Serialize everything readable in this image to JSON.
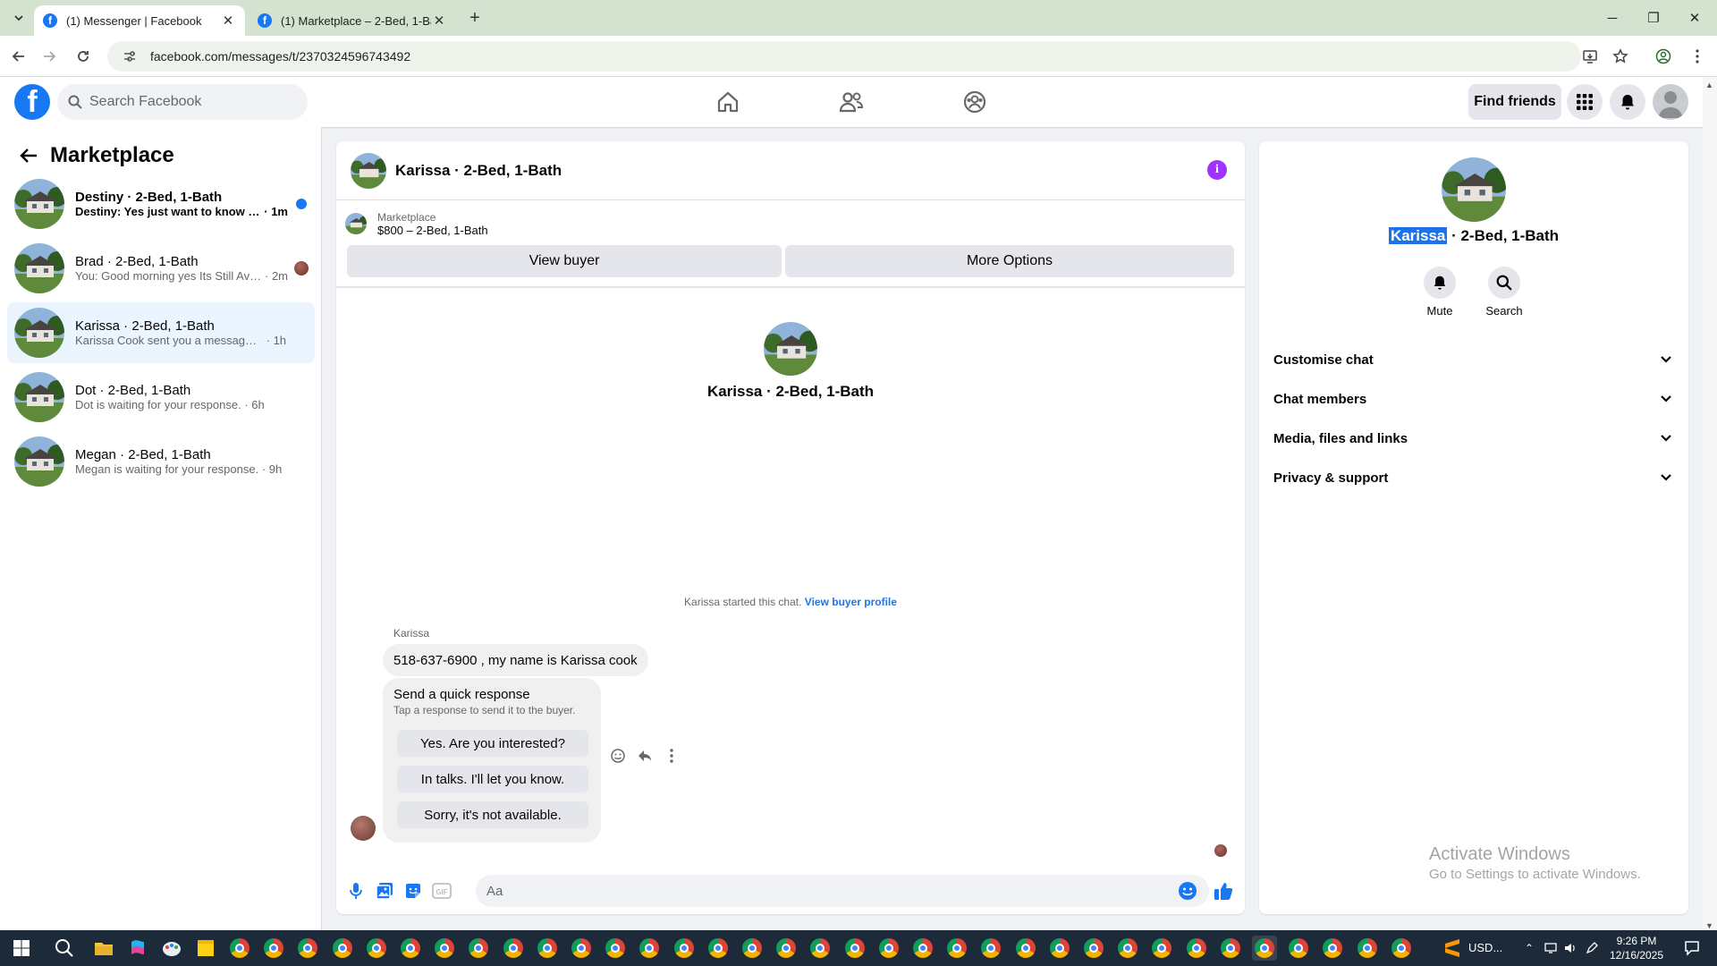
{
  "browser": {
    "tabs": [
      {
        "title": "(1) Messenger | Facebook",
        "active": true
      },
      {
        "title": "(1) Marketplace – 2-Bed, 1-Bath",
        "active": false
      }
    ],
    "url": "facebook.com/messages/t/2370324596743492"
  },
  "fb": {
    "search_placeholder": "Search Facebook",
    "find_friends": "Find friends"
  },
  "left": {
    "title": "Marketplace",
    "conversations": [
      {
        "name": "Destiny · 2-Bed, 1-Bath",
        "preview": "Destiny: Yes just want to know the...",
        "time": "1m",
        "unread": true,
        "selected": false
      },
      {
        "name": "Brad · 2-Bed, 1-Bath",
        "preview": "You: Good morning yes Its Still Ava...",
        "time": "2m",
        "unread": false,
        "selected": false
      },
      {
        "name": "Karissa · 2-Bed, 1-Bath",
        "preview": "Karissa Cook sent you a message abo...",
        "time": "1h",
        "unread": false,
        "selected": true
      },
      {
        "name": "Dot · 2-Bed, 1-Bath",
        "preview": "Dot is waiting for your response.",
        "time": "6h",
        "unread": false,
        "selected": false
      },
      {
        "name": "Megan · 2-Bed, 1-Bath",
        "preview": "Megan is waiting for your response.",
        "time": "9h",
        "unread": false,
        "selected": false
      }
    ]
  },
  "chat": {
    "title": "Karissa · 2-Bed, 1-Bath",
    "listing_source": "Marketplace",
    "listing_price": "$800 – 2-Bed, 1-Bath",
    "view_buyer": "View buyer",
    "more_options": "More Options",
    "big_name": "Karissa · 2-Bed, 1-Bath",
    "started_text": "Karissa started this chat.",
    "view_profile": "View buyer profile",
    "sender": "Karissa",
    "message": "518-637-6900 , my name is Karissa cook",
    "quick_title": "Send a quick response",
    "quick_subtitle": "Tap a response to send it to the buyer.",
    "quick_responses": [
      "Yes. Are you interested?",
      "In talks. I'll let you know.",
      "Sorry, it's not available."
    ],
    "input_placeholder": "Aa"
  },
  "right": {
    "name_highlight": "Karissa",
    "name_rest": " · 2-Bed, 1-Bath",
    "actions": [
      {
        "label": "Mute",
        "icon": "bell-icon"
      },
      {
        "label": "Search",
        "icon": "search-icon"
      }
    ],
    "sections": [
      "Customise chat",
      "Chat members",
      "Media, files and links",
      "Privacy & support"
    ]
  },
  "watermark": {
    "line1": "Activate Windows",
    "line2": "Go to Settings to activate Windows."
  },
  "taskbar": {
    "tray_text": "USD...",
    "time": "9:26 PM",
    "date": "12/16/2025"
  },
  "colors": {
    "fb_blue": "#1877f2",
    "selected_bg": "#ebf5ff",
    "info_purple": "#a033ff",
    "taskbar": "#1c2a3a"
  }
}
